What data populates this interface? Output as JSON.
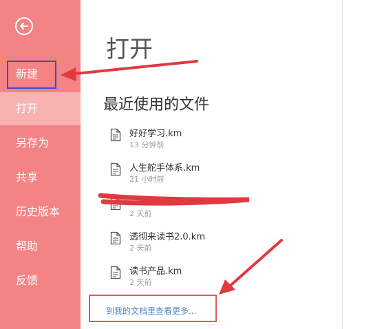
{
  "sidebar": {
    "items": [
      {
        "label": "新建"
      },
      {
        "label": "打开"
      },
      {
        "label": "另存为"
      },
      {
        "label": "共享"
      },
      {
        "label": "历史版本"
      },
      {
        "label": "帮助"
      },
      {
        "label": "反馈"
      }
    ]
  },
  "main": {
    "title": "打开",
    "recent_title": "最近使用的文件",
    "files": [
      {
        "name": "好好学习.km",
        "time": "13 分钟前"
      },
      {
        "name": "人生舵手体系.km",
        "time": "21 小时前"
      },
      {
        "name": "",
        "time": "2 天前"
      },
      {
        "name": "透彻来读书2.0.km",
        "time": "2 天前"
      },
      {
        "name": "读书产品.km",
        "time": "2 天前"
      }
    ],
    "more_link": "到我的文档里查看更多..."
  },
  "colors": {
    "sidebar_bg": "#f48385",
    "active_item_bg": "#f9b2b2",
    "annotation_red": "#e0393e",
    "highlight_blue": "#3a4ad8",
    "link_blue": "#4a86c8"
  },
  "icons": {
    "back": "back-arrow-circle-icon",
    "file": "document-icon"
  }
}
